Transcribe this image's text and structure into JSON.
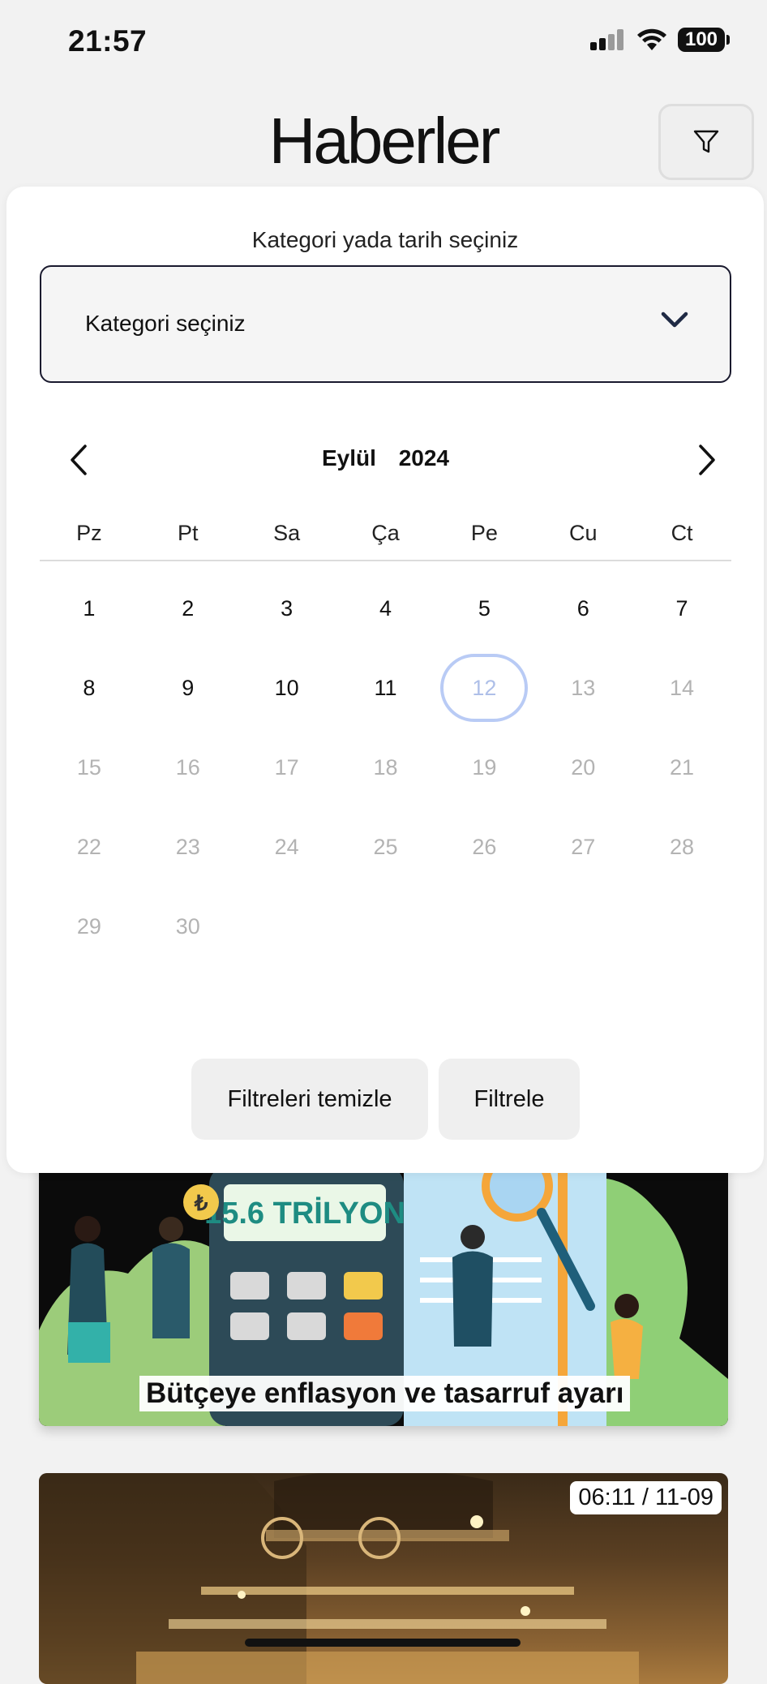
{
  "status_bar": {
    "time": "21:57",
    "battery": "100"
  },
  "header": {
    "title": "Haberler",
    "filter_icon": "funnel-icon"
  },
  "filter_sheet": {
    "heading": "Kategori yada tarih seçiniz",
    "category_select": {
      "value": "Kategori seçiniz",
      "icon": "chevron-down-icon"
    },
    "calendar": {
      "month": "Eylül",
      "year": "2024",
      "weekdays": [
        "Pz",
        "Pt",
        "Sa",
        "Ça",
        "Pe",
        "Cu",
        "Ct"
      ],
      "days": [
        {
          "label": "1",
          "disabled": false
        },
        {
          "label": "2",
          "disabled": false
        },
        {
          "label": "3",
          "disabled": false
        },
        {
          "label": "4",
          "disabled": false
        },
        {
          "label": "5",
          "disabled": false
        },
        {
          "label": "6",
          "disabled": false
        },
        {
          "label": "7",
          "disabled": false
        },
        {
          "label": "8",
          "disabled": false
        },
        {
          "label": "9",
          "disabled": false
        },
        {
          "label": "10",
          "disabled": false
        },
        {
          "label": "11",
          "disabled": false
        },
        {
          "label": "12",
          "disabled": true,
          "today": true
        },
        {
          "label": "13",
          "disabled": true
        },
        {
          "label": "14",
          "disabled": true
        },
        {
          "label": "15",
          "disabled": true
        },
        {
          "label": "16",
          "disabled": true
        },
        {
          "label": "17",
          "disabled": true
        },
        {
          "label": "18",
          "disabled": true
        },
        {
          "label": "19",
          "disabled": true
        },
        {
          "label": "20",
          "disabled": true
        },
        {
          "label": "21",
          "disabled": true
        },
        {
          "label": "22",
          "disabled": true
        },
        {
          "label": "23",
          "disabled": true
        },
        {
          "label": "24",
          "disabled": true
        },
        {
          "label": "25",
          "disabled": true
        },
        {
          "label": "26",
          "disabled": true
        },
        {
          "label": "27",
          "disabled": true
        },
        {
          "label": "28",
          "disabled": true
        },
        {
          "label": "29",
          "disabled": true
        },
        {
          "label": "30",
          "disabled": true
        }
      ]
    },
    "buttons": {
      "clear": "Filtreleri temizle",
      "apply": "Filtrele"
    }
  },
  "news": [
    {
      "title": "Bütçeye enflasyon ve tasarruf ayarı",
      "image_text": "15.6 TRİLYON"
    },
    {
      "badge": "06:11 / 11-09"
    }
  ],
  "colors": {
    "today_ring": "#b9cbf5",
    "select_border": "#1a1a2e",
    "disabled_day": "#b3b3b3"
  }
}
